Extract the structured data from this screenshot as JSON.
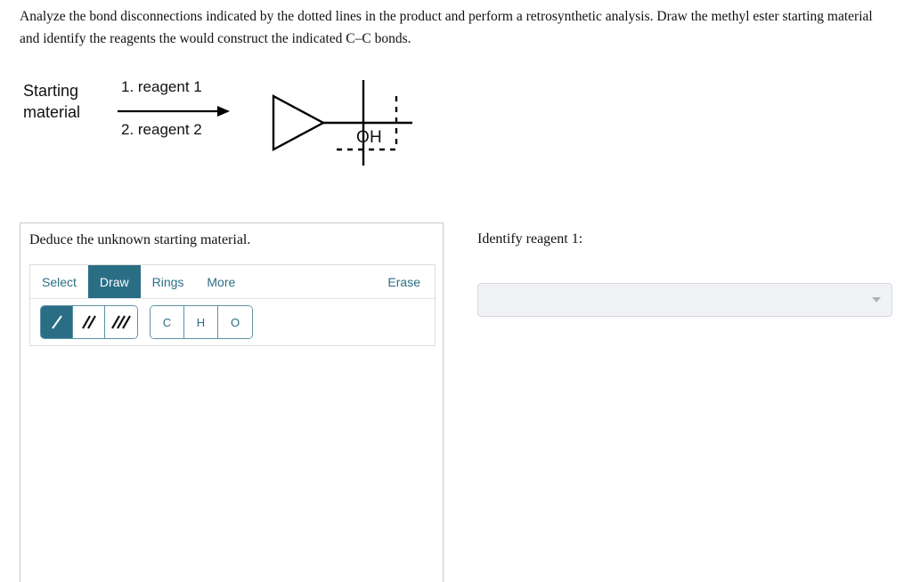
{
  "prompt": {
    "text": "Analyze the bond disconnections indicated by the dotted lines in the product and perform a retrosynthetic analysis. Draw the methyl ester starting material and identify the reagents the would construct the indicated C–C bonds."
  },
  "reaction": {
    "starting_material_label": "Starting\nmaterial",
    "reagent_1_label": "1. reagent 1",
    "reagent_2_label": "2. reagent 2",
    "arrow_icon": "right-arrow-icon",
    "product": {
      "oh_label": "OH",
      "description": "1-cyclopropyl-1-methylethanol with two dashed C–C bond disconnection lines",
      "fragments": [
        "cyclopropyl-ring",
        "quaternary-carbon",
        "hydroxyl-group",
        "methyl-right",
        "methyl-down"
      ],
      "disconnections": [
        "vertical-dashed-line-crossing-right-methyl",
        "horizontal-dashed-line-crossing-down-methyl"
      ]
    }
  },
  "drawing_panel": {
    "prompt": "Deduce the unknown starting material.",
    "tabs": [
      {
        "label": "Select",
        "active": false
      },
      {
        "label": "Draw",
        "active": true
      },
      {
        "label": "Rings",
        "active": false
      },
      {
        "label": "More",
        "active": false
      }
    ],
    "erase_label": "Erase",
    "bond_tools": [
      {
        "name": "single-bond",
        "icon": "single-bond-icon",
        "selected": true
      },
      {
        "name": "double-bond",
        "icon": "double-bond-icon",
        "selected": false
      },
      {
        "name": "triple-bond",
        "icon": "triple-bond-icon",
        "selected": false
      }
    ],
    "atom_tools": [
      {
        "label": "C"
      },
      {
        "label": "H"
      },
      {
        "label": "O"
      }
    ],
    "canvas_content": ""
  },
  "reagent_section": {
    "question": "Identify reagent 1:",
    "select_value": "",
    "select_placeholder": "",
    "caret_icon": "chevron-down-icon"
  },
  "colors": {
    "accent_teal": "#2a6e85",
    "accent_text": "#2b6e83",
    "panel_border": "#c9c9c9",
    "select_bg": "#f0f2f5",
    "select_border": "#d5d8dc"
  }
}
